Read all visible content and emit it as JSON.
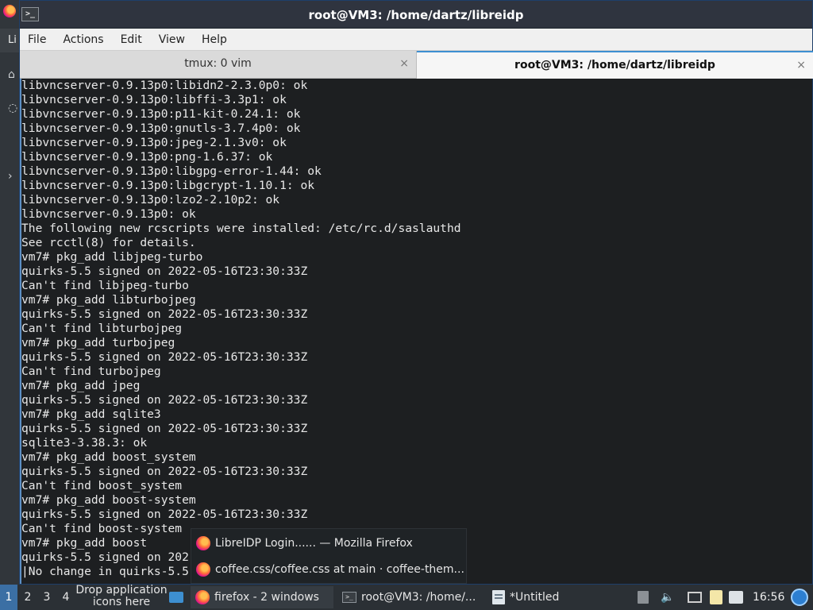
{
  "background_app": {
    "label": "Li",
    "symbols": [
      "⌂",
      "◌",
      "›"
    ]
  },
  "window": {
    "title": "root@VM3: /home/dartz/libreidp",
    "app_icon": ">_"
  },
  "menubar": {
    "items": [
      "File",
      "Actions",
      "Edit",
      "View",
      "Help"
    ]
  },
  "tabs": [
    {
      "label": "tmux: 0 vim",
      "close": "×"
    },
    {
      "label": "root@VM3: /home/dartz/libreidp",
      "close": "×"
    }
  ],
  "terminal": {
    "lines": [
      "libvncserver-0.9.13p0:libidn2-2.3.0p0: ok",
      "libvncserver-0.9.13p0:libffi-3.3p1: ok",
      "libvncserver-0.9.13p0:p11-kit-0.24.1: ok",
      "libvncserver-0.9.13p0:gnutls-3.7.4p0: ok",
      "libvncserver-0.9.13p0:jpeg-2.1.3v0: ok",
      "libvncserver-0.9.13p0:png-1.6.37: ok",
      "libvncserver-0.9.13p0:libgpg-error-1.44: ok",
      "libvncserver-0.9.13p0:libgcrypt-1.10.1: ok",
      "libvncserver-0.9.13p0:lzo2-2.10p2: ok",
      "libvncserver-0.9.13p0: ok",
      "The following new rcscripts were installed: /etc/rc.d/saslauthd",
      "See rcctl(8) for details.",
      "vm7# pkg_add libjpeg-turbo",
      "quirks-5.5 signed on 2022-05-16T23:30:33Z",
      "Can't find libjpeg-turbo",
      "vm7# pkg_add libturbojpeg",
      "quirks-5.5 signed on 2022-05-16T23:30:33Z",
      "Can't find libturbojpeg",
      "vm7# pkg_add turbojpeg",
      "quirks-5.5 signed on 2022-05-16T23:30:33Z",
      "Can't find turbojpeg",
      "vm7# pkg_add jpeg",
      "quirks-5.5 signed on 2022-05-16T23:30:33Z",
      "vm7# pkg_add sqlite3",
      "quirks-5.5 signed on 2022-05-16T23:30:33Z",
      "sqlite3-3.38.3: ok",
      "vm7# pkg_add boost_system",
      "quirks-5.5 signed on 2022-05-16T23:30:33Z",
      "Can't find boost_system",
      "vm7# pkg_add boost-system",
      "quirks-5.5 signed on 2022-05-16T23:30:33Z",
      "Can't find boost-system",
      "vm7# pkg_add boost",
      "quirks-5.5 signed on 202",
      "|No change in quirks-5.5"
    ]
  },
  "popup": {
    "items": [
      "LibreIDP Login...... — Mozilla Firefox",
      "coffee.css/coffee.css at main · coffee-them..."
    ]
  },
  "taskbar": {
    "workspaces": [
      "1",
      "2",
      "3",
      "4"
    ],
    "drop_hint": "Drop application icons here",
    "tasks": [
      {
        "label": "firefox - 2 windows",
        "icon": "firefox-icon"
      },
      {
        "label": "root@VM3: /home/...",
        "icon": "terminal-icon"
      },
      {
        "label": "*Untitled",
        "icon": "text-editor-icon"
      }
    ],
    "volume_icon": "🔈",
    "clock": "16:56"
  },
  "colors": {
    "accent": "#3d8fd1",
    "terminal_bg": "#1d1f21",
    "terminal_fg": "#e8e8e8",
    "taskbar_bg": "#2b3035"
  }
}
